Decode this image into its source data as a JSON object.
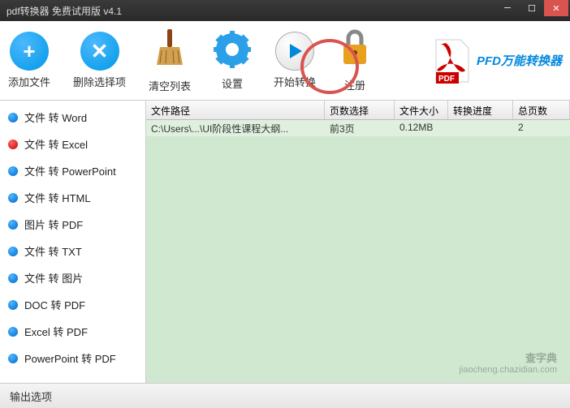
{
  "title": "pdf转换器 免费试用版 v4.1",
  "toolbar": {
    "add": "添加文件",
    "remove": "删除选择项",
    "clear": "清空列表",
    "settings": "设置",
    "start": "开始转换",
    "register": "注册"
  },
  "brand": {
    "text": "PFD万能转换器",
    "badge": "PDF"
  },
  "sidebar": {
    "items": [
      {
        "label": "文件 转 Word",
        "active": false
      },
      {
        "label": "文件 转 Excel",
        "active": true
      },
      {
        "label": "文件 转 PowerPoint",
        "active": false
      },
      {
        "label": "文件 转 HTML",
        "active": false
      },
      {
        "label": "图片 转 PDF",
        "active": false
      },
      {
        "label": "文件 转 TXT",
        "active": false
      },
      {
        "label": "文件 转 图片",
        "active": false
      },
      {
        "label": "DOC 转 PDF",
        "active": false
      },
      {
        "label": "Excel 转 PDF",
        "active": false
      },
      {
        "label": "PowerPoint 转 PDF",
        "active": false
      }
    ]
  },
  "table": {
    "headers": {
      "path": "文件路径",
      "pages": "页数选择",
      "size": "文件大小",
      "progress": "转换进度",
      "total": "总页数"
    },
    "rows": [
      {
        "path": "C:\\Users\\...\\UI阶段性课程大纲...",
        "pages": "前3页",
        "size": "0.12MB",
        "progress": "",
        "total": "2"
      }
    ]
  },
  "footer": {
    "output": "输出选项"
  },
  "watermark": {
    "main": "查字典",
    "sub": "jiaocheng.chazidian.com"
  }
}
